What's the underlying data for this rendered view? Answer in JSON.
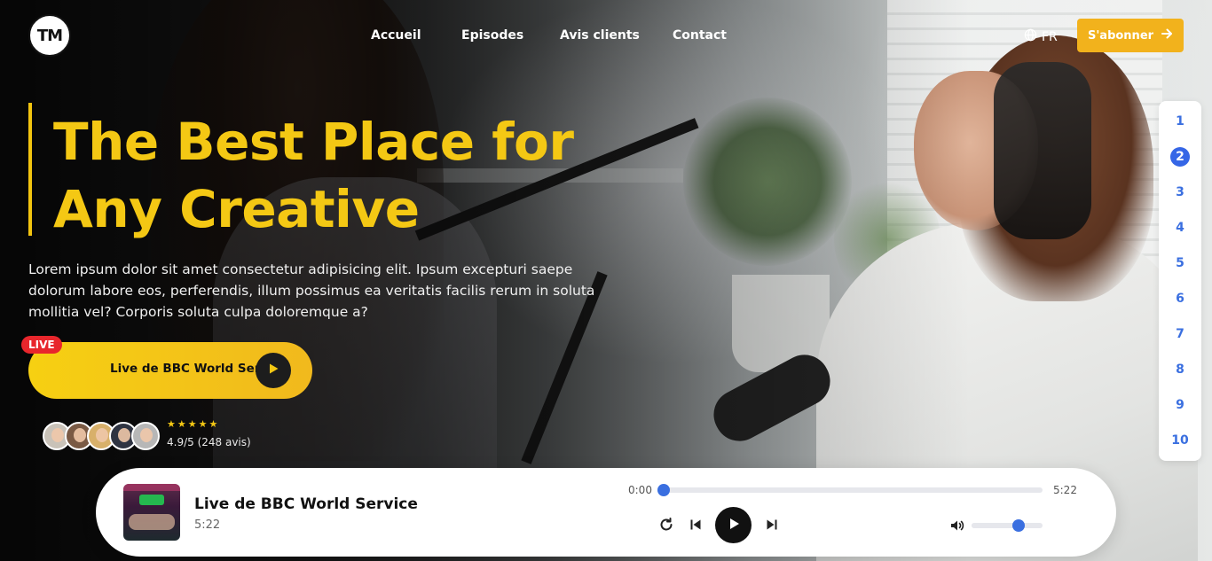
{
  "header": {
    "logo_text": "TM",
    "nav": [
      "Accueil",
      "Episodes",
      "Avis clients",
      "Contact"
    ],
    "language": "FR",
    "subscribe_label": "S'abonner"
  },
  "hero": {
    "title_line1": "The Best Place for",
    "title_line2": "Any Creative",
    "description": "Lorem ipsum dolor sit amet consectetur adipisicing elit. Ipsum excepturi saepe dolorum labore eos, perferendis, illum possimus ea veritatis facilis rerum in soluta mollitia vel? Corporis soluta culpa doloremque a?",
    "live_badge": "LIVE",
    "live_label": "Live de BBC World Serv..."
  },
  "reviews": {
    "stars": "★★★★★",
    "rating_text": "4.9/5 (248 avis)"
  },
  "episode_index": {
    "numbers": [
      "1",
      "2",
      "3",
      "4",
      "5",
      "6",
      "7",
      "8",
      "9",
      "10"
    ],
    "active": "2"
  },
  "player": {
    "title": "Live de BBC World Service",
    "duration": "5:22",
    "time_current": "0:00",
    "time_total": "5:22",
    "progress_fraction": 0,
    "volume_fraction": 0.66
  },
  "colors": {
    "accent_yellow": "#f4c814",
    "subscribe_bg": "#f2b21c",
    "live_red": "#e8262c",
    "accent_blue": "#3a6fe0"
  },
  "icons": {
    "language": "globe-icon",
    "subscribe": "arrow-right-icon",
    "live_play": "play-icon",
    "replay": "replay-icon",
    "prev": "skip-previous-icon",
    "play": "play-icon",
    "next": "skip-next-icon",
    "volume": "volume-icon"
  }
}
